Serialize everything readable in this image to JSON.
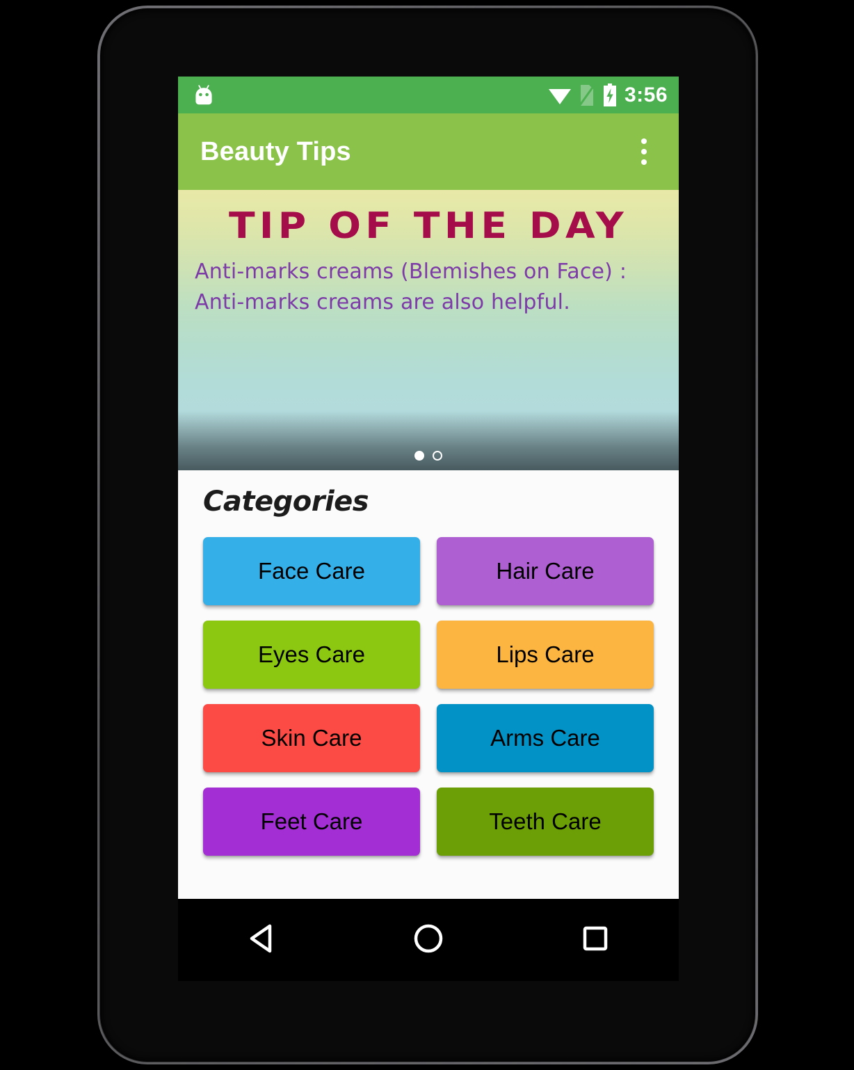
{
  "device": {
    "frame_color": "#0a0a0a",
    "bezel_highlight": "#78787c"
  },
  "status_bar": {
    "background": "#4CAF50",
    "time": "3:56",
    "icons": [
      {
        "name": "android-head-icon",
        "label": "Android notification"
      },
      {
        "name": "wifi-icon",
        "label": "Wi-Fi full signal"
      },
      {
        "name": "no-sim-icon",
        "label": "No SIM card"
      },
      {
        "name": "battery-charging-icon",
        "label": "Battery charging"
      }
    ]
  },
  "toolbar": {
    "background": "#8BC34A",
    "title": "Beauty Tips",
    "overflow_label": "More options"
  },
  "tip_card": {
    "heading": "TIP OF THE DAY",
    "heading_color": "#a50d4a",
    "body": "Anti-marks creams (Blemishes on Face) : Anti-marks creams are also helpful.",
    "body_color": "#7d3ba8",
    "gradient_top": "#e8e9a8",
    "gradient_bottom": "#b8d9e2",
    "page_indicators": [
      {
        "name": "page-dot-1",
        "active": true
      },
      {
        "name": "page-dot-2",
        "active": false
      }
    ]
  },
  "categories": {
    "title": "Categories",
    "background": "#fbfbfc",
    "items": [
      {
        "name": "category-face-care",
        "label": "Face Care",
        "color": "#35AFE8"
      },
      {
        "name": "category-hair-care",
        "label": "Hair Care",
        "color": "#AE5FD1"
      },
      {
        "name": "category-eyes-care",
        "label": "Eyes Care",
        "color": "#8CC711"
      },
      {
        "name": "category-lips-care",
        "label": "Lips Care",
        "color": "#FBB540"
      },
      {
        "name": "category-skin-care",
        "label": "Skin Care",
        "color": "#FC4A45"
      },
      {
        "name": "category-arms-care",
        "label": "Arms Care",
        "color": "#0392C6"
      },
      {
        "name": "category-feet-care",
        "label": "Feet Care",
        "color": "#A32FD4"
      },
      {
        "name": "category-teeth-care",
        "label": "Teeth Care",
        "color": "#6C9F05"
      }
    ]
  },
  "nav_bar": {
    "background": "#000000",
    "buttons": [
      {
        "name": "nav-back-button",
        "label": "Back"
      },
      {
        "name": "nav-home-button",
        "label": "Home"
      },
      {
        "name": "nav-recents-button",
        "label": "Recents"
      }
    ]
  }
}
